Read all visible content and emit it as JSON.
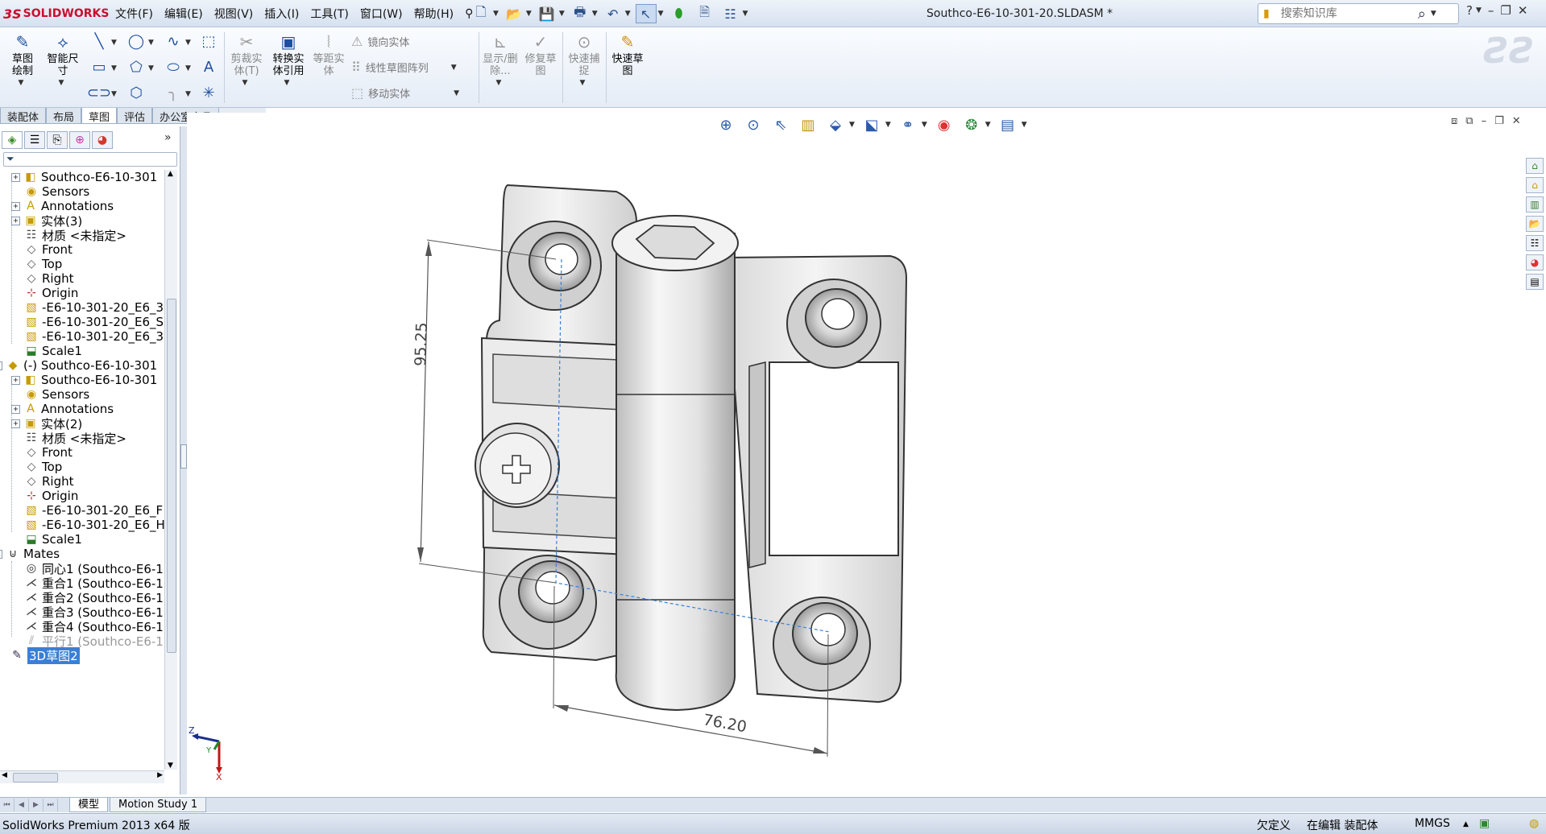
{
  "app": {
    "logo_ds": "3S",
    "logo_brand": "SOLIDWORKS",
    "document_title": "Southco-E6-10-301-20.SLDASM *"
  },
  "menu": [
    "文件(F)",
    "编辑(E)",
    "视图(V)",
    "插入(I)",
    "工具(T)",
    "窗口(W)",
    "帮助(H)"
  ],
  "search": {
    "placeholder": "搜索知识库"
  },
  "ribbon": {
    "sketch": "草图绘制",
    "smart_dim": "智能尺寸",
    "trim": "剪裁实体(T)",
    "convert": "转换实体引用",
    "offset": "等距实体",
    "mirror": "镜向实体",
    "linear_pattern": "线性草图阵列",
    "move": "移动实体",
    "display_delete": "显示/删除...",
    "repair": "修复草图",
    "quick_snap": "快速捕捉",
    "rapid_sketch": "快速草图"
  },
  "cm_tabs": [
    "装配体",
    "布局",
    "草图",
    "评估",
    "办公室产品"
  ],
  "cm_active_tab": "草图",
  "tree": [
    {
      "label": "Southco-E6-10-301",
      "icon": "part-icon",
      "expander": "+"
    },
    {
      "label": "Sensors",
      "icon": "sensors-icon",
      "expander": ""
    },
    {
      "label": "Annotations",
      "icon": "annotations-icon",
      "expander": "+"
    },
    {
      "label": "实体(3)",
      "icon": "solid-bodies-icon",
      "expander": "+"
    },
    {
      "label": "材质 <未指定>",
      "icon": "material-icon",
      "expander": ""
    },
    {
      "label": "Front",
      "icon": "plane-icon",
      "expander": ""
    },
    {
      "label": "Top",
      "icon": "plane-icon",
      "expander": ""
    },
    {
      "label": "Right",
      "icon": "plane-icon",
      "expander": ""
    },
    {
      "label": "Origin",
      "icon": "origin-icon",
      "expander": ""
    },
    {
      "label": "-E6-10-301-20_E6_3",
      "icon": "feature-icon",
      "expander": ""
    },
    {
      "label": "-E6-10-301-20_E6_S",
      "icon": "feature-icon",
      "expander": ""
    },
    {
      "label": "-E6-10-301-20_E6_3",
      "icon": "feature-icon",
      "expander": ""
    },
    {
      "label": "Scale1",
      "icon": "scale-icon",
      "expander": ""
    },
    {
      "label": "(-) Southco-E6-10-301",
      "icon": "assembly-part-icon",
      "expander": "-"
    },
    {
      "label": "Southco-E6-10-301",
      "icon": "part-icon",
      "expander": "+"
    },
    {
      "label": "Sensors",
      "icon": "sensors-icon",
      "expander": ""
    },
    {
      "label": "Annotations",
      "icon": "annotations-icon",
      "expander": "+"
    },
    {
      "label": "实体(2)",
      "icon": "solid-bodies-icon",
      "expander": "+"
    },
    {
      "label": "材质 <未指定>",
      "icon": "material-icon",
      "expander": ""
    },
    {
      "label": "Front",
      "icon": "plane-icon",
      "expander": ""
    },
    {
      "label": "Top",
      "icon": "plane-icon",
      "expander": ""
    },
    {
      "label": "Right",
      "icon": "plane-icon",
      "expander": ""
    },
    {
      "label": "Origin",
      "icon": "origin-icon",
      "expander": ""
    },
    {
      "label": "-E6-10-301-20_E6_F",
      "icon": "feature-icon",
      "expander": ""
    },
    {
      "label": "-E6-10-301-20_E6_H",
      "icon": "feature-icon",
      "expander": ""
    },
    {
      "label": "Scale1",
      "icon": "scale-icon",
      "expander": ""
    },
    {
      "label": "Mates",
      "icon": "mates-icon",
      "expander": "-"
    },
    {
      "label": "同心1 (Southco-E6-1",
      "icon": "concentric-mate-icon",
      "expander": ""
    },
    {
      "label": "重合1 (Southco-E6-1",
      "icon": "coincident-mate-icon",
      "expander": ""
    },
    {
      "label": "重合2 (Southco-E6-1",
      "icon": "coincident-mate-icon",
      "expander": ""
    },
    {
      "label": "重合3 (Southco-E6-1",
      "icon": "coincident-mate-icon",
      "expander": ""
    },
    {
      "label": "重合4 (Southco-E6-1",
      "icon": "coincident-mate-icon",
      "expander": ""
    },
    {
      "label": "平行1 (Southco-E6-1",
      "icon": "parallel-mate-icon",
      "expander": ""
    },
    {
      "label": "3D草图2",
      "icon": "3d-sketch-icon",
      "expander": ""
    }
  ],
  "dimensions": {
    "vertical": "95.25",
    "horizontal": "76.20"
  },
  "triad": {
    "z": "Z",
    "y": "Y",
    "x": "X"
  },
  "bottom_tabs": [
    "模型",
    "Motion Study 1"
  ],
  "status": {
    "product": "SolidWorks Premium 2013 x64 版",
    "definition": "欠定义",
    "mode": "在编辑 装配体",
    "units": "MMGS"
  }
}
